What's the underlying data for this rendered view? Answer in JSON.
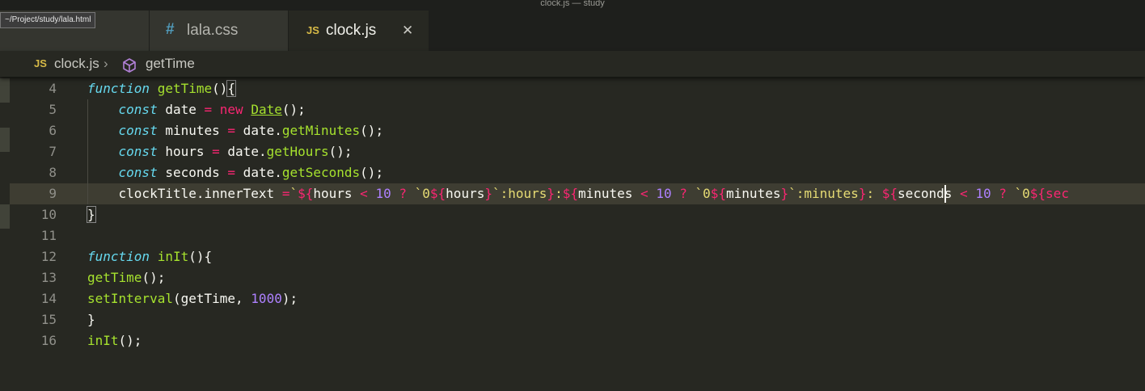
{
  "window": {
    "title": "clock.js — study"
  },
  "tooltip": {
    "text": "~/Project/study/lala.html"
  },
  "tabs": [
    {
      "label": "",
      "icon": "html-file-icon"
    },
    {
      "label": "lala.css",
      "icon_glyph": "#",
      "icon": "css-file-icon"
    },
    {
      "label": "clock.js",
      "icon_glyph": "JS",
      "icon": "js-file-icon",
      "active": true,
      "close_glyph": "✕"
    }
  ],
  "breadcrumb": {
    "file_icon_text": "JS",
    "file": "clock.js",
    "separator": "›",
    "symbol_icon": "method-cube-icon",
    "symbol": "getTime"
  },
  "colors": {
    "background": "#272822",
    "keyword": "#66d9ef",
    "function": "#a6e22e",
    "operator": "#f92672",
    "number": "#ae81ff",
    "string": "#e6db74"
  },
  "editor": {
    "active_line": 9,
    "lines": [
      {
        "n": "4",
        "t": [
          "function",
          " ",
          "getTime",
          "()",
          "{"
        ]
      },
      {
        "n": "5",
        "t": [
          "    ",
          "const",
          " date ",
          "=",
          " ",
          "new",
          " ",
          "Date",
          "();"
        ]
      },
      {
        "n": "6",
        "t": [
          "    ",
          "const",
          " minutes ",
          "=",
          " date.",
          "getMinutes",
          "();"
        ]
      },
      {
        "n": "7",
        "t": [
          "    ",
          "const",
          " hours ",
          "=",
          " date.",
          "getHours",
          "();"
        ]
      },
      {
        "n": "8",
        "t": [
          "    ",
          "const",
          " seconds ",
          "=",
          " date.",
          "getSeconds",
          "();"
        ]
      },
      {
        "n": "9",
        "t": [
          "    clockTitle.innerText ",
          "=",
          "`",
          "${",
          "hours ",
          "<",
          " ",
          "10",
          " ",
          "?",
          " ",
          "`0",
          "${",
          "hours",
          "}",
          "`",
          ":hours",
          "}",
          ":",
          "${",
          "minutes ",
          "<",
          " ",
          "10",
          " ",
          "?",
          " ",
          "`0",
          "${",
          "minutes",
          "}",
          "`",
          ":minutes",
          "}",
          ": ",
          "${",
          "seconds ",
          "<",
          " ",
          "10",
          " ",
          "?",
          " ",
          "`0",
          "${sec"
        ]
      },
      {
        "n": "10",
        "t": [
          "}"
        ]
      },
      {
        "n": "11",
        "t": [
          ""
        ]
      },
      {
        "n": "12",
        "t": [
          "function",
          " ",
          "inIt",
          "(){"
        ]
      },
      {
        "n": "13",
        "t": [
          "getTime",
          "();"
        ]
      },
      {
        "n": "14",
        "t": [
          "setInterval",
          "(getTime, ",
          "1000",
          ");"
        ]
      },
      {
        "n": "15",
        "t": [
          "}"
        ]
      },
      {
        "n": "16",
        "t": [
          "inIt",
          "();"
        ]
      }
    ]
  }
}
